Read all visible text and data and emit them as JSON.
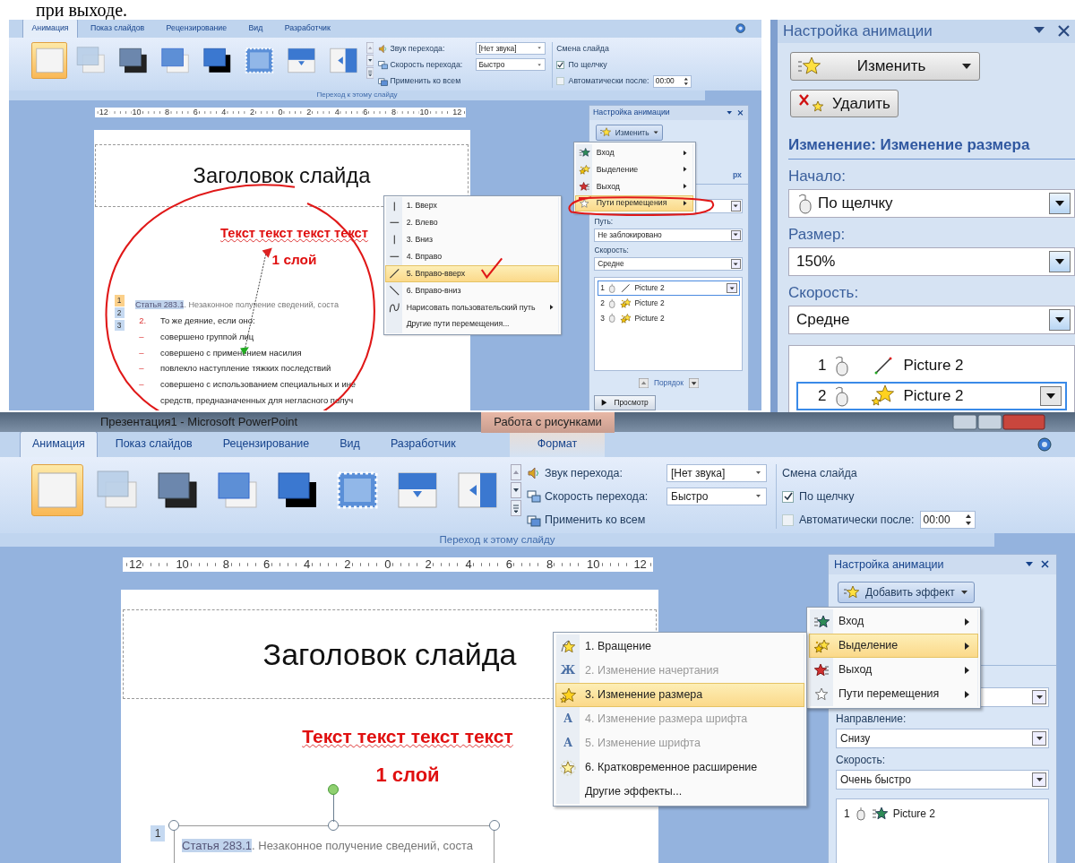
{
  "doc_text": "при выходе.",
  "windows": [
    {
      "tabs": [
        {
          "label": "Анимация",
          "selected": true
        },
        {
          "label": "Показ слайдов",
          "selected": false
        },
        {
          "label": "Рецензирование",
          "selected": false
        },
        {
          "label": "Вид",
          "selected": false
        },
        {
          "label": "Разработчик",
          "selected": false
        }
      ],
      "transitions": [
        {
          "selected": true
        },
        {
          "selected": false
        },
        {
          "selected": false
        },
        {
          "selected": false
        },
        {
          "selected": false
        },
        {
          "selected": false
        },
        {
          "selected": false
        },
        {
          "selected": false
        }
      ],
      "sound": {
        "label": "Звук перехода:",
        "value": "[Нет звука]"
      },
      "speed": {
        "label": "Скорость перехода:",
        "value": "Быстро"
      },
      "apply_all": "Применить ко всем",
      "slide_change": {
        "title": "Смена слайда",
        "on_click": {
          "label": "По щелчку",
          "checked": true
        },
        "auto": {
          "label": "Автоматически после:",
          "checked": false,
          "value": "00:00"
        }
      },
      "group_label": "Переход к этому слайду",
      "ruler": [
        "12",
        "10",
        "8",
        "6",
        "4",
        "2",
        "0",
        "2",
        "4",
        "6",
        "8",
        "10",
        "12"
      ],
      "slide": {
        "title": "Заголовок слайда",
        "red_text": "Текст текст текст текст",
        "layer": "1 слой",
        "motion_path": true,
        "tags": [
          {
            "label": "1",
            "selected": true
          },
          {
            "label": "2",
            "selected": false
          },
          {
            "label": "3",
            "selected": false
          }
        ],
        "article": "Статья 283.1",
        "article_rest": ". Незаконное получение сведений, соста",
        "lines": [
          {
            "marker": "2.",
            "text": "То же деяние, если оно:"
          },
          {
            "marker": "–",
            "text": "совершено группой лиц"
          },
          {
            "marker": "–",
            "text": "совершено с применением насилия"
          },
          {
            "marker": "–",
            "text": "повлекло наступление тяжких последствий"
          },
          {
            "marker": "–",
            "text": "совершено с использованием специальных и ине"
          },
          {
            "text": "средств, предназначенных для негласного получ"
          }
        ]
      },
      "pane": {
        "title": "Настройка анимации",
        "effect_button": "Изменить",
        "heading_fragment": "рх",
        "fields": [
          {
            "kind": "covered"
          },
          {
            "label": "Путь:",
            "value": "Не заблокировано"
          },
          {
            "label": "Скорость:",
            "value": "Средне"
          }
        ],
        "effects": [
          {
            "number": "1",
            "name": "Picture 2",
            "kind": "path",
            "selected": true
          },
          {
            "number": "2",
            "name": "Picture 2",
            "kind": "emphasis",
            "selected": false
          },
          {
            "number": "3",
            "name": "Picture 2",
            "kind": "emphasis",
            "selected": false
          }
        ],
        "order_label": "Порядок",
        "preview": "Просмотр"
      },
      "menu": [
        {
          "label": "Вход",
          "kind": "entrance",
          "highlighted": false
        },
        {
          "label": "Выделение",
          "kind": "emphasis",
          "highlighted": false
        },
        {
          "label": "Выход",
          "kind": "exit",
          "highlighted": false
        },
        {
          "label": "Пути перемещения",
          "kind": "path",
          "highlighted": true
        }
      ],
      "submenu": [
        {
          "label": "1. Вверх",
          "kind": "vertical",
          "highlighted": false,
          "disabled": false
        },
        {
          "label": "2. Влево",
          "kind": "horizontal",
          "highlighted": false,
          "disabled": false
        },
        {
          "label": "3. Вниз",
          "kind": "vertical",
          "highlighted": false,
          "disabled": false
        },
        {
          "label": "4. Вправо",
          "kind": "horizontal",
          "highlighted": false,
          "disabled": false
        },
        {
          "label": "5. Вправо-вверх",
          "kind": "diagonal_up",
          "highlighted": true,
          "disabled": false
        },
        {
          "label": "6. Вправо-вниз",
          "kind": "diagonal_down",
          "highlighted": false,
          "disabled": false
        },
        {
          "label": "Нарисовать пользовательский путь",
          "kind": "custom",
          "highlighted": false,
          "disabled": false,
          "has_submenu": true
        },
        {
          "label": "Другие пути перемещения...",
          "kind": "none",
          "highlighted": false,
          "disabled": false
        }
      ],
      "annotations": [
        {
          "kind": "circle"
        },
        {
          "kind": "menu_circle"
        },
        {
          "kind": "check"
        }
      ]
    },
    {
      "title": "Презентация1 - Microsoft PowerPoint",
      "context_group": "Работа с рисунками",
      "tabs": [
        {
          "label": "Анимация",
          "selected": true
        },
        {
          "label": "Показ слайдов",
          "selected": false
        },
        {
          "label": "Рецензирование",
          "selected": false
        },
        {
          "label": "Вид",
          "selected": false
        },
        {
          "label": "Разработчик",
          "selected": false
        },
        {
          "label": "Формат",
          "selected": false,
          "kind": "contextual"
        }
      ],
      "transitions": [
        {
          "selected": true
        },
        {
          "selected": false
        },
        {
          "selected": false
        },
        {
          "selected": false
        },
        {
          "selected": false
        },
        {
          "selected": false
        },
        {
          "selected": false
        },
        {
          "selected": false
        }
      ],
      "sound": {
        "label": "Звук перехода:",
        "value": "[Нет звука]"
      },
      "speed": {
        "label": "Скорость перехода:",
        "value": "Быстро"
      },
      "apply_all": "Применить ко всем",
      "slide_change": {
        "title": "Смена слайда",
        "on_click": {
          "label": "По щелчку",
          "checked": true
        },
        "auto": {
          "label": "Автоматически после:",
          "checked": false,
          "value": "00:00"
        }
      },
      "group_label": "Переход к этому слайду",
      "ruler": [
        "12",
        "10",
        "8",
        "6",
        "4",
        "2",
        "0",
        "2",
        "4",
        "6",
        "8",
        "10",
        "12"
      ],
      "slide": {
        "title": "Заголовок слайда",
        "red_text": "Текст текст текст текст",
        "layer": "1 слой",
        "selected_box": true,
        "tags": [
          {
            "label": "1",
            "selected": false
          }
        ],
        "article": "Статья 283.1",
        "article_rest": ". Незаконное получение сведений, соста"
      },
      "pane": {
        "title": "Настройка анимации",
        "effect_button": "Добавить эффект",
        "fields": [
          {
            "kind": "covered"
          },
          {
            "label": "Направление:",
            "value": "Снизу"
          },
          {
            "label": "Скорость:",
            "value": "Очень быстро"
          }
        ],
        "effects": [
          {
            "number": "1",
            "name": "Picture 2",
            "kind": "entrance",
            "selected": false
          }
        ]
      },
      "menu": [
        {
          "label": "Вход",
          "kind": "entrance",
          "highlighted": false
        },
        {
          "label": "Выделение",
          "kind": "emphasis",
          "highlighted": true
        },
        {
          "label": "Выход",
          "kind": "exit",
          "highlighted": false
        },
        {
          "label": "Пути перемещения",
          "kind": "path",
          "highlighted": false
        }
      ],
      "submenu": [
        {
          "label": "1. Вращение",
          "kind": "spin",
          "highlighted": false,
          "disabled": false
        },
        {
          "label": "2. Изменение начертания",
          "kind": "glyph",
          "glyph": "Ж",
          "highlighted": false,
          "disabled": true
        },
        {
          "label": "3. Изменение размера",
          "kind": "grow",
          "highlighted": true,
          "disabled": false
        },
        {
          "label": "4. Изменение размера шрифта",
          "kind": "glyph",
          "glyph": "A",
          "highlighted": false,
          "disabled": true
        },
        {
          "label": "5. Изменение шрифта",
          "kind": "glyph",
          "glyph": "A",
          "highlighted": false,
          "disabled": true
        },
        {
          "label": "6. Кратковременное расширение",
          "kind": "flicker",
          "highlighted": false,
          "disabled": false
        },
        {
          "label": "Другие эффекты...",
          "kind": "none",
          "highlighted": false,
          "disabled": false
        }
      ]
    }
  ],
  "zoom_pane": {
    "title": "Настройка анимации",
    "change_button": "Изменить",
    "delete_button": "Удалить",
    "heading": "Изменение: Изменение размера",
    "fields": [
      {
        "label": "Начало:",
        "value": "По щелчку",
        "kind": "click"
      },
      {
        "label": "Размер:",
        "value": "150%"
      },
      {
        "label": "Скорость:",
        "value": "Средне"
      }
    ],
    "effects": [
      {
        "number": "1",
        "name": "Picture 2",
        "kind": "path",
        "selected": false
      },
      {
        "number": "2",
        "name": "Picture 2",
        "kind": "emphasis",
        "selected": true
      }
    ]
  }
}
